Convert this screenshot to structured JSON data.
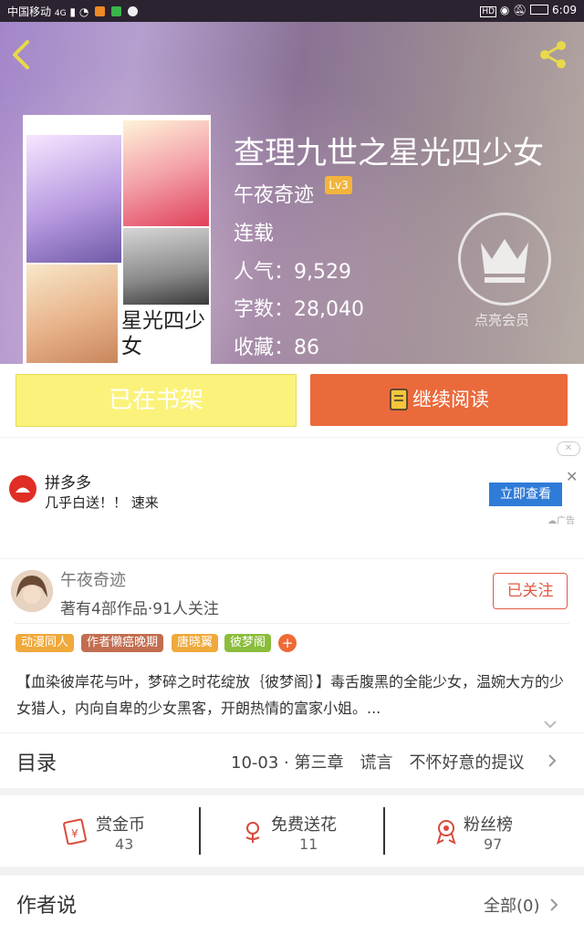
{
  "status_bar": {
    "carrier": "中国移动",
    "network": "4G",
    "time": "6:09"
  },
  "book": {
    "title": "查理九世之星光四少女",
    "author": "午夜奇迹",
    "author_level": "Lv3",
    "status": "连载",
    "popularity_label": "人气：",
    "popularity": "9,529",
    "word_count_label": "字数：",
    "word_count": "28,040",
    "favorites_label": "收藏：",
    "favorites": "86",
    "cover_title": "星光四少女"
  },
  "vip": {
    "label": "点亮会员"
  },
  "actions": {
    "shelf_label": "已在书架",
    "read_label": "继续阅读"
  },
  "ad": {
    "title": "拼多多",
    "subtitle": "几乎白送！！ 速来",
    "button": "立即查看",
    "mark": "广告"
  },
  "author_card": {
    "name": "午夜奇迹",
    "stats": "著有4部作品·91人关注",
    "follow_label": "已关注"
  },
  "tags": [
    {
      "label": "动漫同人",
      "color": "#f0a93b"
    },
    {
      "label": "作者懒癌晚期",
      "color": "#c26d4f"
    },
    {
      "label": "唐晓翼",
      "color": "#f0a93b"
    },
    {
      "label": "彼梦阁",
      "color": "#8bbd3c"
    }
  ],
  "intro": "【血染彼岸花与叶，梦碎之时花绽放｛彼梦阁｝】毒舌腹黑的全能少女，温婉大方的少女猎人，内向自卑的少女黑客，开朗热情的富家小姐。...",
  "toc": {
    "label": "目录",
    "latest": "10-03 · 第三章　谎言　不怀好意的提议"
  },
  "stats": [
    {
      "label": "赏金币",
      "value": "43",
      "icon": "red-envelope-icon"
    },
    {
      "label": "免费送花",
      "value": "11",
      "icon": "flower-icon"
    },
    {
      "label": "粉丝榜",
      "value": "97",
      "icon": "medal-icon"
    }
  ],
  "author_says": {
    "label": "作者说",
    "all_label": "全部(0)"
  },
  "colors": {
    "accent_orange": "#ea6a3b",
    "shelf_yellow": "#fbf27b",
    "follow_red": "#e05a42",
    "ad_blue": "#2f7bd8"
  }
}
